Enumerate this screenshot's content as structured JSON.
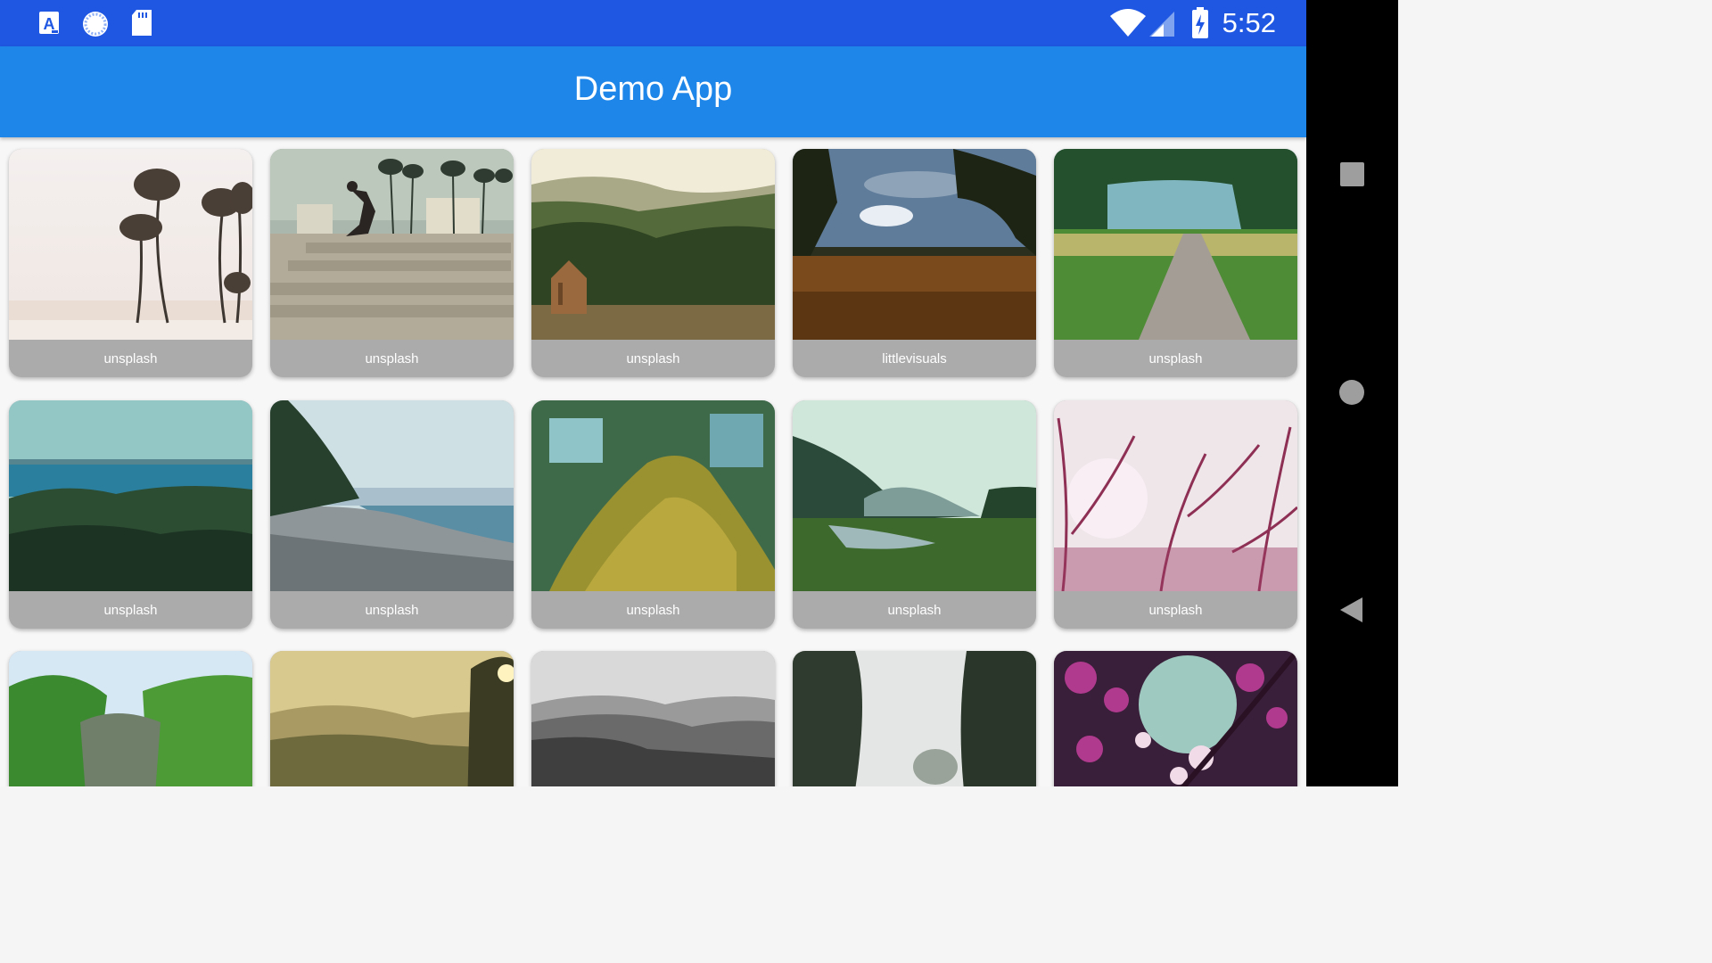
{
  "status_bar": {
    "time": "5:52",
    "icons": [
      "translate-app-icon",
      "loading-spinner-icon",
      "sd-card-icon",
      "wifi-icon",
      "cellular-signal-icon",
      "battery-charging-icon"
    ]
  },
  "app_bar": {
    "title": "Demo App"
  },
  "grid": {
    "cards": [
      {
        "caption": "unsplash",
        "image": "palm trees on beach"
      },
      {
        "caption": "unsplash",
        "image": "skateboarder at skate park"
      },
      {
        "caption": "unsplash",
        "image": "wooden hut on forested hill"
      },
      {
        "caption": "littlevisuals",
        "image": "field under cloudy sky"
      },
      {
        "caption": "unsplash",
        "image": "gravel path through meadow"
      },
      {
        "caption": "unsplash",
        "image": "forest above blue sea"
      },
      {
        "caption": "unsplash",
        "image": "pebble beach shoreline"
      },
      {
        "caption": "unsplash",
        "image": "mossy tree trunk"
      },
      {
        "caption": "unsplash",
        "image": "river valley with mist"
      },
      {
        "caption": "unsplash",
        "image": "pink tree branches"
      },
      {
        "caption": "",
        "image": "green forest ravine"
      },
      {
        "caption": "",
        "image": "hazy hills at sunset"
      },
      {
        "caption": "",
        "image": "black and white hills"
      },
      {
        "caption": "",
        "image": "tree lined road in fog"
      },
      {
        "caption": "",
        "image": "pink blossoms"
      }
    ]
  },
  "nav_bar": {
    "buttons": [
      "recents-button",
      "home-button",
      "back-button"
    ]
  },
  "colors": {
    "status_bar": "#1f57e3",
    "app_bar": "#1f86e9",
    "card_caption_bg": "#ababab"
  }
}
